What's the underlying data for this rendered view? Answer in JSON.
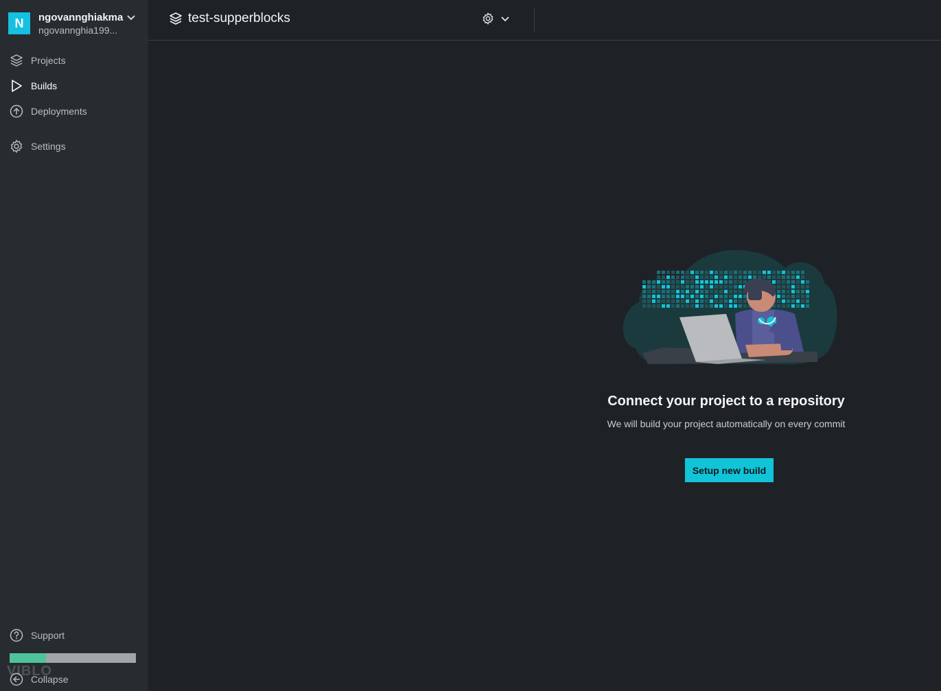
{
  "account": {
    "initial": "N",
    "name": "ngovannghiakma",
    "email": "ngovannghia199..."
  },
  "sidebar": {
    "items": [
      {
        "label": "Projects",
        "icon": "layers-icon"
      },
      {
        "label": "Builds",
        "icon": "play-icon",
        "active": true
      },
      {
        "label": "Deployments",
        "icon": "upload-circle-icon"
      },
      {
        "label": "Settings",
        "icon": "gear-icon"
      }
    ],
    "support_label": "Support",
    "collapse_label": "Collapse",
    "usage_progress": 0.29,
    "watermark": "VIBLO"
  },
  "header": {
    "project_title": "test-supperblocks"
  },
  "empty_state": {
    "title": "Connect your project to a repository",
    "subtitle": "We will build your project automatically on every commit",
    "button_label": "Setup new build"
  },
  "colors": {
    "accent": "#12c4d8",
    "sidebar_bg": "#272c31",
    "main_bg": "#1e2226",
    "progress_fill": "#4fc49a"
  }
}
